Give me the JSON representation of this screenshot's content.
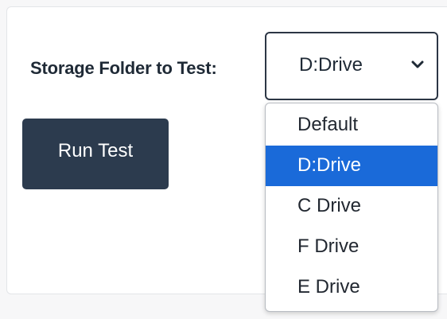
{
  "form": {
    "label": "Storage Folder to Test:",
    "selected_value": "D:Drive",
    "chevron_icon": "chevron-down-icon",
    "run_button_label": "Run Test"
  },
  "dropdown": {
    "options": [
      "Default",
      "D:Drive",
      "C Drive",
      "F Drive",
      "E Drive"
    ],
    "highlighted_index": 1
  },
  "colors": {
    "button_bg": "#2c3b4e",
    "highlight": "#1a6ad9",
    "select_border": "#2c3645"
  }
}
